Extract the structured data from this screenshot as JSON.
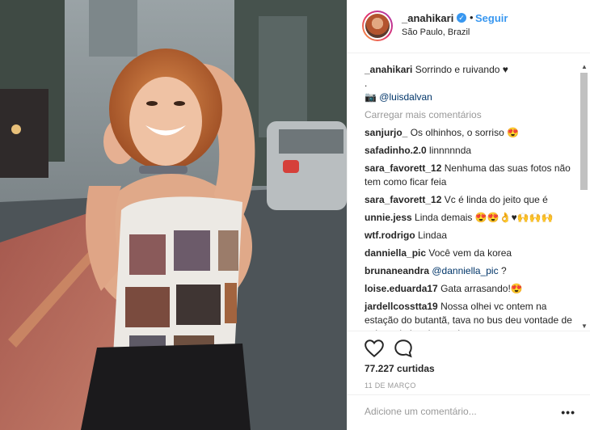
{
  "post": {
    "username": "_anahikari",
    "follow_label": "Seguir",
    "dot": "•",
    "location": "São Paulo, Brazil",
    "caption": {
      "username": "_anahikari",
      "text": "Sorrindo e ruivando ♥",
      "line2": ".",
      "line3_prefix": "📷",
      "mention": "@luisdalvan"
    },
    "load_more": "Carregar mais comentários",
    "comments": [
      {
        "user": "sanjurjo_",
        "text": "Os olhinhos, o sorriso 😍"
      },
      {
        "user": "safadinho.2.0",
        "text": "linnnnnda"
      },
      {
        "user": "sara_favorett_12",
        "text": "Nenhuma das suas fotos não tem como ficar feia"
      },
      {
        "user": "sara_favorett_12",
        "text": "Vc é linda do jeito que é"
      },
      {
        "user": "unnie.jess",
        "text": "Linda demais 😍😍👌♥🙌🙌🙌"
      },
      {
        "user": "wtf.rodrigo",
        "text": "Lindaa"
      },
      {
        "user": "danniella_pic",
        "text": "Você vem da korea"
      },
      {
        "user": "brunaneandra",
        "mention": "@danniella_pic",
        "text": " ?"
      },
      {
        "user": "loise.eduarda17",
        "text": "Gata arrasando!😍"
      },
      {
        "user": "jardellcosstta19",
        "text": "Nossa olhei vc ontem na estação do butantã, tava no bus deu vontade de pular pela janela pra tirar uma"
      }
    ],
    "likes": "77.227 curtidas",
    "date": "11 DE MARÇO",
    "comment_placeholder": "Adicione um comentário...",
    "more_label": "•••",
    "verified_glyph": "✓"
  },
  "icons": {
    "like": "heart-outline-icon",
    "comment": "speech-bubble-icon",
    "verified": "verified-badge-icon"
  },
  "colors": {
    "link": "#3897f0",
    "mention": "#003569",
    "muted": "#999999"
  }
}
